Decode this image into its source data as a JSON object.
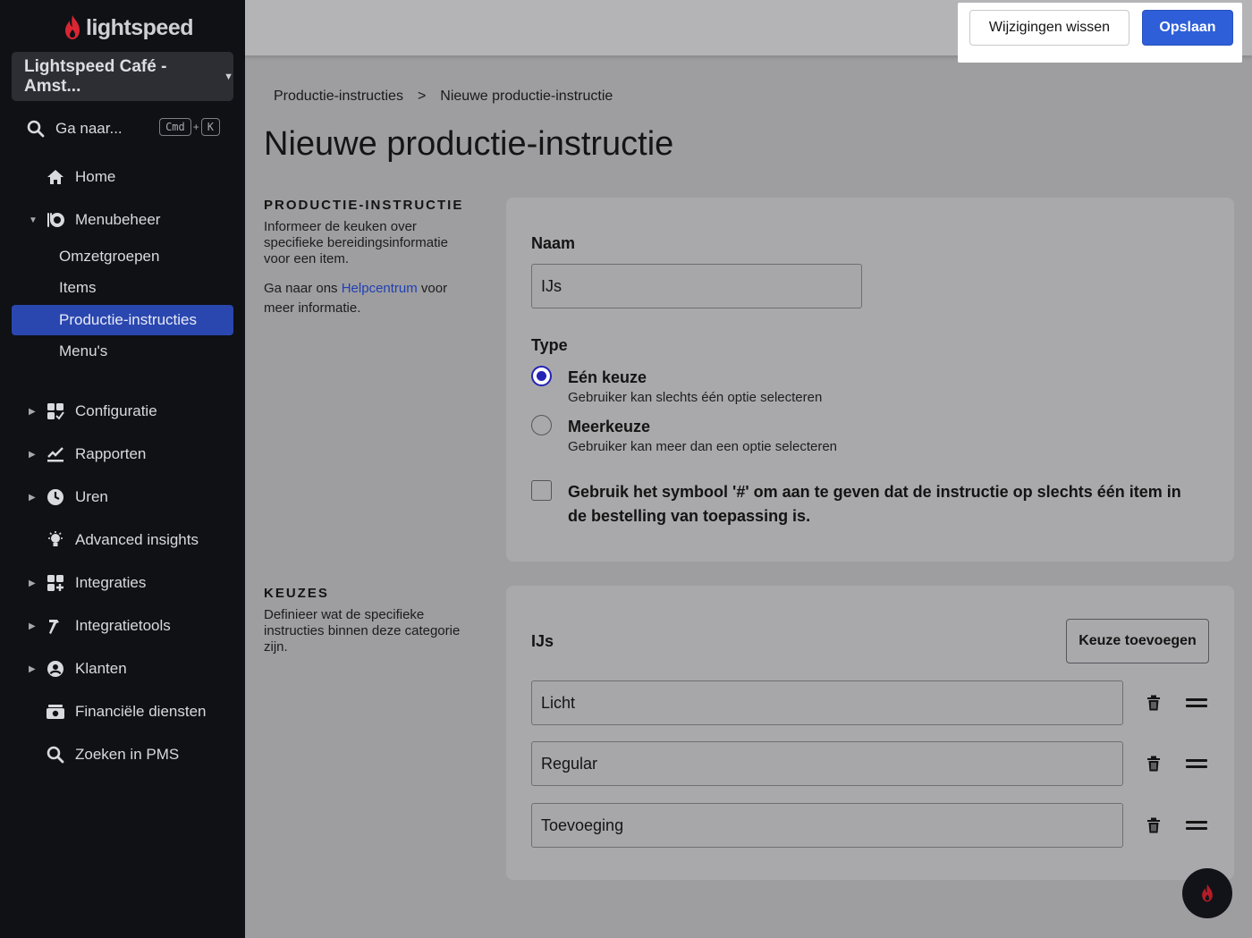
{
  "sidebar": {
    "logo_text": "lightspeed",
    "venue": "Lightspeed Café - Amst...",
    "goto": {
      "label": "Ga naar...",
      "key1": "Cmd",
      "plus": "+",
      "key2": "K"
    },
    "nav": [
      {
        "label": "Home",
        "icon": "home-icon"
      },
      {
        "label": "Menubeheer",
        "icon": "menu-management-icon",
        "expanded": true
      },
      {
        "label": "Configuratie",
        "icon": "configuration-icon"
      },
      {
        "label": "Rapporten",
        "icon": "reports-icon"
      },
      {
        "label": "Uren",
        "icon": "clock-icon"
      },
      {
        "label": "Advanced insights",
        "icon": "lightbulb-icon"
      },
      {
        "label": "Integraties",
        "icon": "integrations-icon"
      },
      {
        "label": "Integratietools",
        "icon": "hammer-icon"
      },
      {
        "label": "Klanten",
        "icon": "customer-icon"
      },
      {
        "label": "Financiële diensten",
        "icon": "money-icon"
      },
      {
        "label": "Zoeken in PMS",
        "icon": "search-icon"
      }
    ],
    "sub_items": [
      "Omzetgroepen",
      "Items",
      "Productie-instructies",
      "Menu's"
    ],
    "active_sub": "Productie-instructies"
  },
  "toolbar": {
    "clear_label": "Wijzigingen wissen",
    "save_label": "Opslaan"
  },
  "breadcrumb": {
    "parent": "Productie-instructies",
    "separator": ">",
    "current": "Nieuwe productie-instructie"
  },
  "page_title": "Nieuwe productie-instructie",
  "section1": {
    "heading": "PRODUCTIE-INSTRUCTIE",
    "description": "Informeer de keuken over specifieke bereidingsinformatie voor een item.",
    "help_prefix": "Ga naar ons ",
    "help_link": "Helpcentrum",
    "help_suffix": " voor meer informatie."
  },
  "form": {
    "name_label": "Naam",
    "name_value": "IJs",
    "type_label": "Type",
    "options": [
      {
        "title": "Eén keuze",
        "sub": "Gebruiker kan slechts één optie selecteren",
        "checked": true
      },
      {
        "title": "Meerkeuze",
        "sub": "Gebruiker kan meer dan een optie selecteren",
        "checked": false
      }
    ],
    "checkbox_label": "Gebruik het symbool '#' om aan te geven dat de instructie op slechts één item in de bestelling van toepassing is."
  },
  "section2": {
    "heading": "KEUZES",
    "description": "Definieer wat de specifieke instructies binnen deze categorie zijn."
  },
  "choices": {
    "title": "IJs",
    "add_label": "Keuze toevoegen",
    "items": [
      "Licht",
      "Regular",
      "Toevoeging"
    ]
  },
  "colors": {
    "accent": "#2e5fd9",
    "sidebar_bg": "#0f1115",
    "active_nav": "#2a47b0",
    "brand_red": "#e4222e"
  }
}
